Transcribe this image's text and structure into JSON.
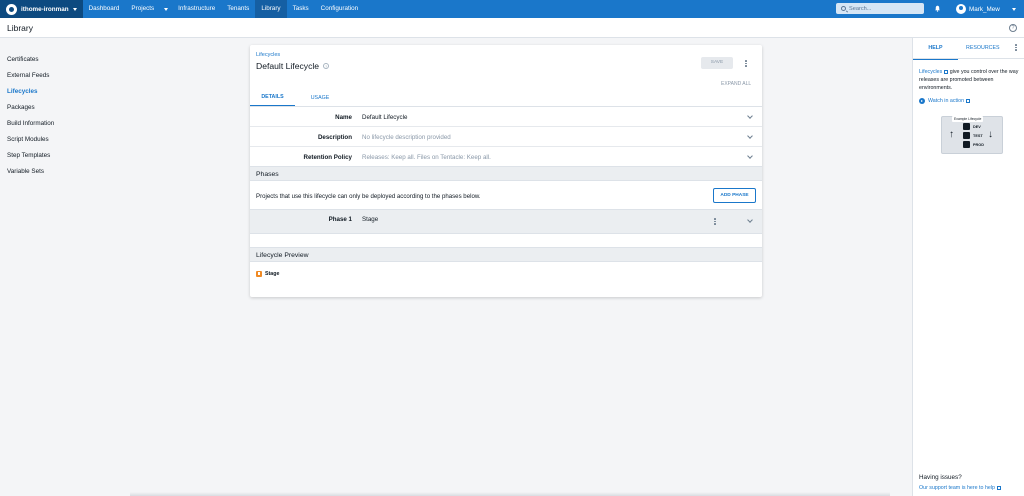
{
  "topnav": {
    "space": "ithome-ironman",
    "items": [
      "Dashboard",
      "Projects",
      "Infrastructure",
      "Tenants",
      "Library",
      "Tasks",
      "Configuration"
    ],
    "active": "Library",
    "search_placeholder": "Search...",
    "user": "Mark_Mew"
  },
  "area": {
    "title": "Library"
  },
  "sidebar": {
    "items": [
      {
        "label": "Certificates"
      },
      {
        "label": "External Feeds"
      },
      {
        "label": "Lifecycles"
      },
      {
        "label": "Packages"
      },
      {
        "label": "Build Information"
      },
      {
        "label": "Script Modules"
      },
      {
        "label": "Step Templates"
      },
      {
        "label": "Variable Sets"
      }
    ],
    "active": "Lifecycles"
  },
  "card": {
    "breadcrumb": "Lifecycles",
    "title": "Default Lifecycle",
    "save_label": "SAVE",
    "expand_all": "EXPAND ALL",
    "tabs": [
      "DETAILS",
      "USAGE"
    ],
    "fields": [
      {
        "label": "Name",
        "value": "Default Lifecycle"
      },
      {
        "label": "Description",
        "value": "No lifecycle description provided"
      },
      {
        "label": "Retention Policy",
        "value": "Releases: Keep all. Files on Tentacle: Keep all."
      }
    ],
    "phases_title": "Phases",
    "phases_desc": "Projects that use this lifecycle can only be deployed according to the phases below.",
    "add_phase": "ADD PHASE",
    "phase": {
      "label": "Phase 1",
      "value": "Stage"
    },
    "preview_title": "Lifecycle Preview",
    "preview_item": "Stage"
  },
  "help": {
    "tabs": [
      "HELP",
      "RESOURCES"
    ],
    "link": "Lifecycles",
    "text": "give you control over the way releases are promoted between environments.",
    "watch": "Watch in action",
    "diagram_title": "Example Lifecycle",
    "steps": [
      "DEV",
      "TEST",
      "PROD"
    ],
    "issues": "Having issues?",
    "support": "Our support team is here to help"
  }
}
